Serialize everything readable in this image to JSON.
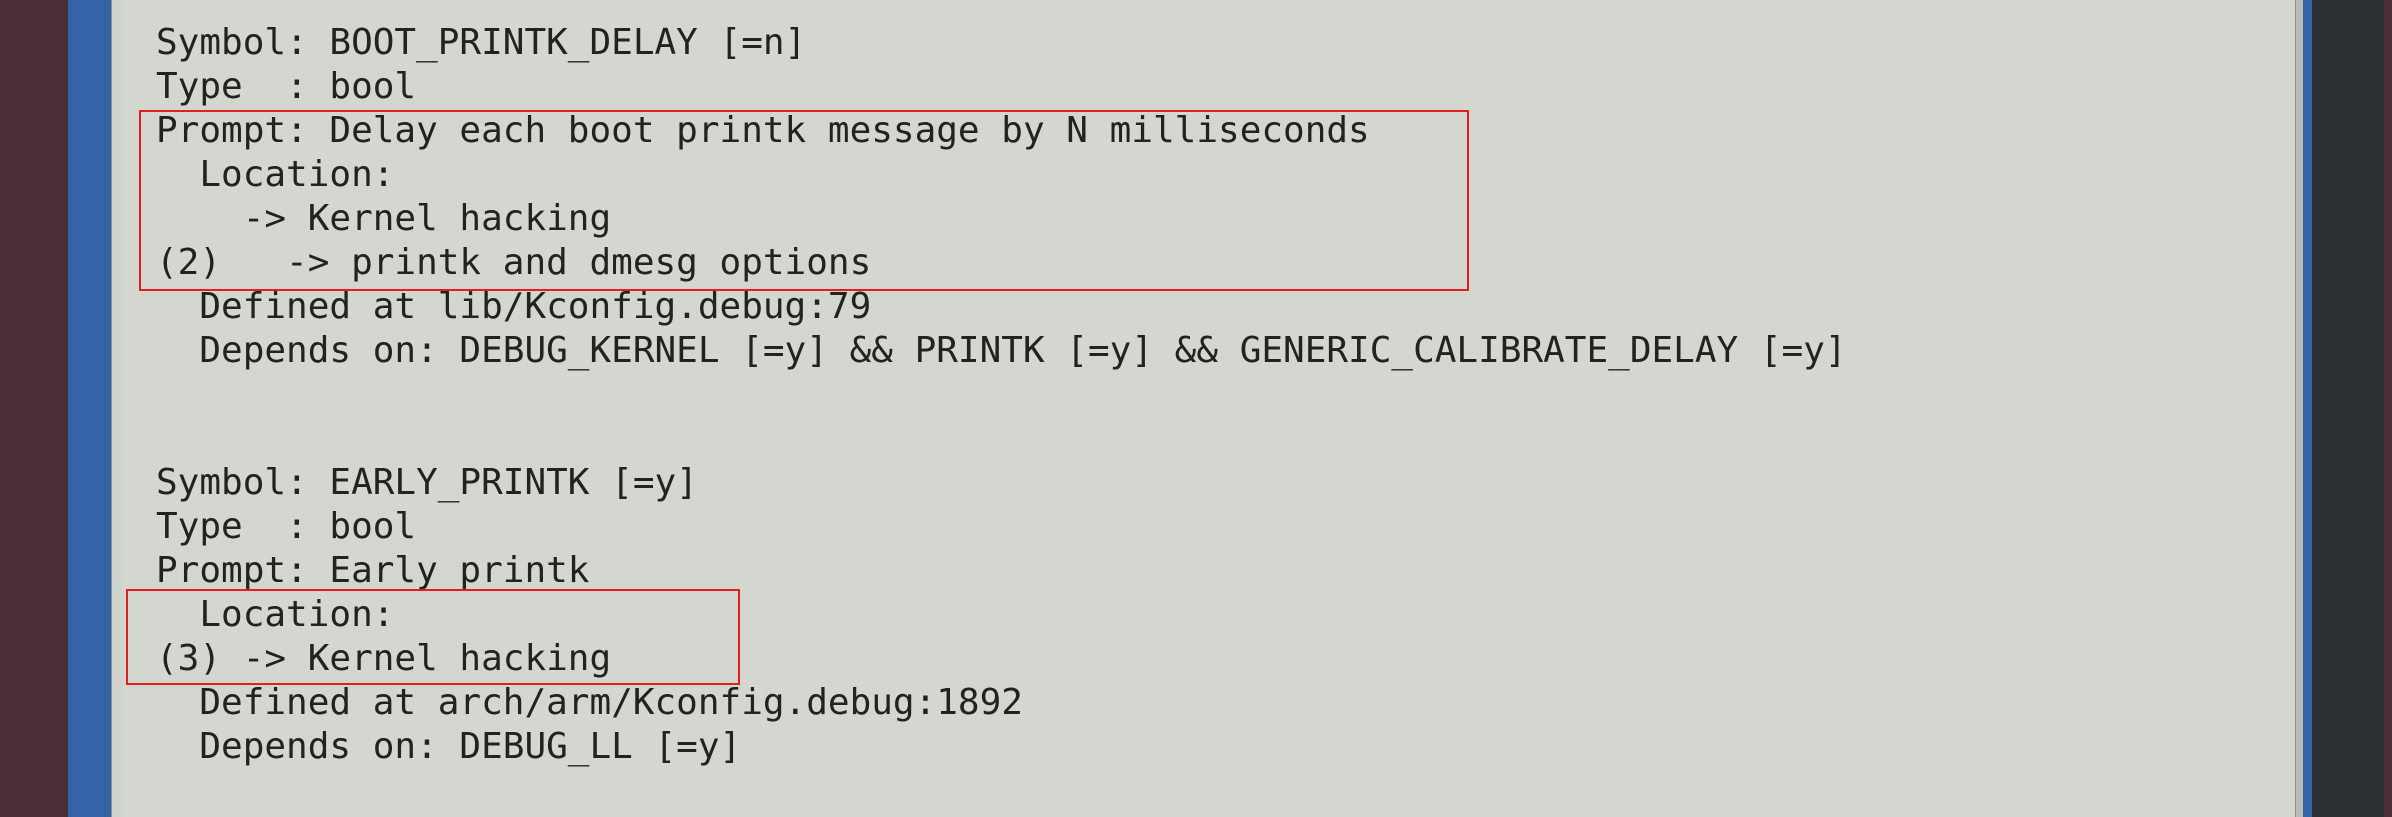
{
  "colors": {
    "background": "#d3d7cf",
    "frame": "#3463a8",
    "text": "#222222",
    "highlight": "#e0201e"
  },
  "symbols": [
    {
      "lines": [
        "Symbol: BOOT_PRINTK_DELAY [=n]",
        "Type  : bool",
        "Prompt: Delay each boot printk message by N milliseconds",
        "  Location:",
        "    -> Kernel hacking",
        "(2)   -> printk and dmesg options",
        "  Defined at lib/Kconfig.debug:79",
        "  Depends on: DEBUG_KERNEL [=y] && PRINTK [=y] && GENERIC_CALIBRATE_DELAY [=y]"
      ]
    },
    {
      "lines": [
        "Symbol: EARLY_PRINTK [=y]",
        "Type  : bool",
        "Prompt: Early printk",
        "  Location:",
        "(3) -> Kernel hacking",
        "  Defined at arch/arm/Kconfig.debug:1892",
        "  Depends on: DEBUG_LL [=y]"
      ]
    }
  ]
}
